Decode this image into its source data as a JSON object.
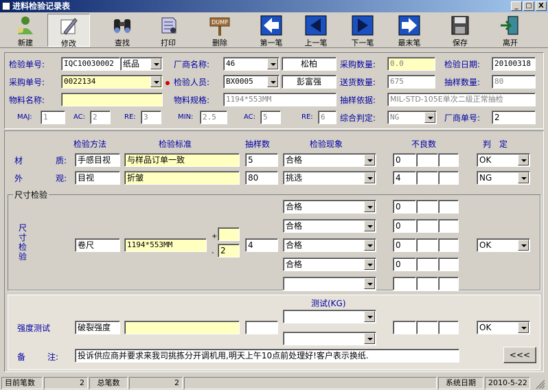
{
  "window": {
    "title": "进料检验记录表",
    "min": "_",
    "max": "□",
    "close": "X"
  },
  "toolbar": [
    {
      "name": "new",
      "label": "新建"
    },
    {
      "name": "edit",
      "label": "修改"
    },
    {
      "name": "find",
      "label": "查找"
    },
    {
      "name": "print",
      "label": "打印"
    },
    {
      "name": "delete",
      "label": "删除",
      "sign": "DUMP"
    },
    {
      "name": "first",
      "label": "第一笔"
    },
    {
      "name": "prev",
      "label": "上一笔"
    },
    {
      "name": "next",
      "label": "下一笔"
    },
    {
      "name": "last",
      "label": "最末笔"
    },
    {
      "name": "save",
      "label": "保存"
    },
    {
      "name": "exit",
      "label": "离开"
    }
  ],
  "header": {
    "inspection_no_label": "检验单号:",
    "inspection_no": "IQC10030002",
    "material_type": "纸品",
    "vendor_name_label": "厂商名称:",
    "vendor_code": "46",
    "vendor_name": "松柏",
    "purchase_qty_label": "采购数量:",
    "purchase_qty": "0.0",
    "inspect_date_label": "检验日期:",
    "inspect_date": "20100318",
    "po_no_label": "采购单号:",
    "po_no": "0022134",
    "inspector_label": "检验人员:",
    "inspector_code": "BX0005",
    "inspector_name": "彭富强",
    "delivery_qty_label": "送货数量:",
    "delivery_qty": "675",
    "sample_qty_label": "抽样数量:",
    "sample_qty": "80",
    "material_name_label": "物料名称:",
    "material_name": "",
    "material_spec_label": "物料规格:",
    "material_spec": "1194*553MM",
    "sampling_basis_label": "抽样依据:",
    "sampling_basis": "MIL-STD-105E单次二级正常抽检",
    "maj_label": "MAJ:",
    "maj": "1",
    "ac1_label": "AC:",
    "ac1": "2",
    "re1_label": "RE:",
    "re1": "3",
    "min_label": "MIN:",
    "min": "2.5",
    "ac2_label": "AC:",
    "ac2": "5",
    "re2_label": "RE:",
    "re2": "6",
    "overall_label": "综合判定:",
    "overall": "NG",
    "vendor_doc_label": "厂商单号:",
    "vendor_doc": "2"
  },
  "columns": {
    "method": "检验方法",
    "standard": "检验标准",
    "samples": "抽样数",
    "phenomenon": "检验现象",
    "defects": "不良数",
    "judge": "判　定"
  },
  "rows": {
    "material": {
      "label_a": "材",
      "label_b": "质:",
      "method": "手感目视",
      "standard": "与样品订单一致",
      "samples": "5",
      "phenomenon": "合格",
      "defect": "0",
      "judge": "OK"
    },
    "appearance": {
      "label_a": "外",
      "label_b": "观:",
      "method": "目视",
      "standard": "折皱",
      "samples": "80",
      "phenomenon": "挑选",
      "defect": "4",
      "judge": "NG"
    }
  },
  "dimension": {
    "group_label": "尺寸检验",
    "side_label": "尺寸检验",
    "method": "卷尺",
    "standard": "1194*553MM",
    "plus": "+",
    "minus": "-",
    "tol_plus": "",
    "tol_minus": "2",
    "samples": "4",
    "phenomena": [
      "合格",
      "合格",
      "合格",
      "合格",
      ""
    ],
    "defects": [
      "0",
      "0",
      "0",
      "0",
      ""
    ],
    "judge": "OK"
  },
  "strength": {
    "test_label": "测试(KG)",
    "label": "强度测试",
    "method": "破裂强度",
    "standard": "",
    "samples": "",
    "judge": "OK"
  },
  "remark": {
    "label_a": "备",
    "label_b": "注:",
    "text": "投诉供应商并要求来我司挑拣分开调机用,明天上午10点前处理好!客户表示换纸.",
    "back_button": "<<<"
  },
  "statusbar": {
    "current_label": "目前笔数",
    "current": "2",
    "total_label": "总笔数",
    "total": "2",
    "sysdate_label": "系统日期",
    "sysdate": "2010-5-22"
  }
}
